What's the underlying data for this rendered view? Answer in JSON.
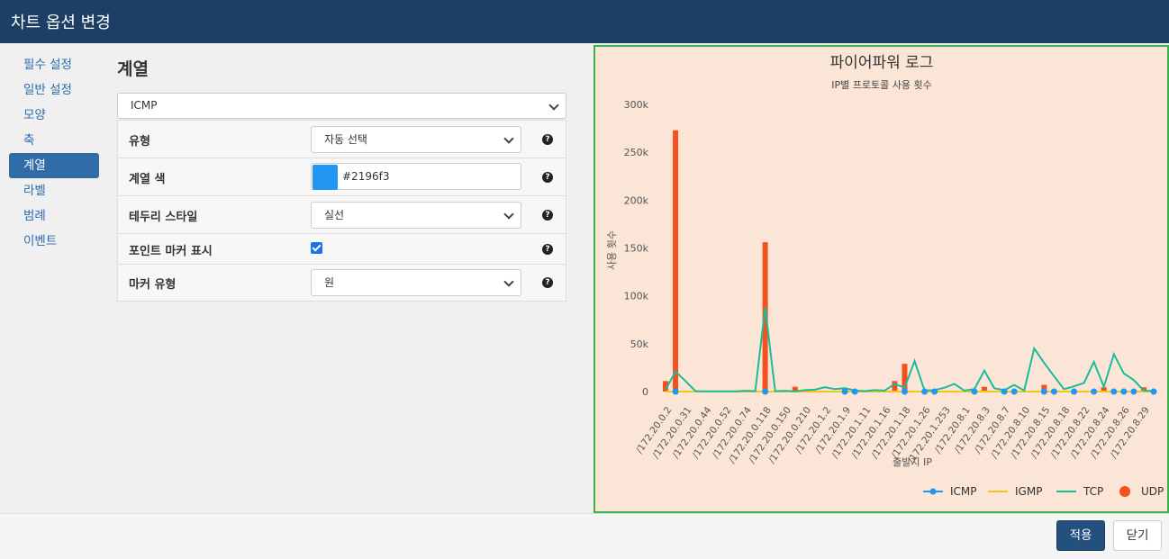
{
  "dialog": {
    "title": "차트 옵션 변경"
  },
  "sidebar": {
    "items": [
      {
        "label": "필수 설정",
        "active": false
      },
      {
        "label": "일반 설정",
        "active": false
      },
      {
        "label": "모양",
        "active": false
      },
      {
        "label": "축",
        "active": false
      },
      {
        "label": "계열",
        "active": true
      },
      {
        "label": "라벨",
        "active": false
      },
      {
        "label": "범례",
        "active": false
      },
      {
        "label": "이벤트",
        "active": false
      }
    ]
  },
  "series_panel": {
    "title": "계열",
    "series_select": "ICMP",
    "rows": {
      "type": {
        "label": "유형",
        "value": "자동 선택"
      },
      "color": {
        "label": "계열 색",
        "value": "#2196f3"
      },
      "border_style": {
        "label": "테두리 스타일",
        "value": "실선"
      },
      "show_marker": {
        "label": "포인트 마커 표시",
        "checked": true
      },
      "marker_type": {
        "label": "마커 유형",
        "value": "원"
      }
    },
    "help_glyph": "?"
  },
  "chart_data": {
    "type": "bar",
    "title": "파이어파워 로그",
    "subtitle": "IP별 프로토콜 사용 횟수",
    "xlabel": "출발지 IP",
    "ylabel": "사용 횟수",
    "ylim": [
      0,
      300000
    ],
    "yticks": [
      "0",
      "50k",
      "100k",
      "150k",
      "200k",
      "250k",
      "300k"
    ],
    "grid": false,
    "legend_position": "bottom-right",
    "background": "#fbe5d6",
    "categories": [
      "/172.20.0.2",
      "/172.20.0.31",
      "/172.20.0.44",
      "/172.20.0.52",
      "/172.20.0.74",
      "/172.20.0.118",
      "/172.20.0.150",
      "/172.20.0.210",
      "/172.20.1.2",
      "/172.20.1.9",
      "/172.20.1.11",
      "/172.20.1.16",
      "/172.20.1.18",
      "/172.20.1.26",
      "/172.20.1.253",
      "/172.20.8.1",
      "/172.20.8.3",
      "/172.20.8.7",
      "/172.20.8.10",
      "/172.20.8.15",
      "/172.20.8.18",
      "/172.20.8.22",
      "/172.20.8.24",
      "/172.20.8.26",
      "/172.20.8.29"
    ],
    "series": [
      {
        "name": "ICMP",
        "type": "line",
        "color": "#2196f3",
        "values": [
          0,
          0,
          null,
          null,
          null,
          0,
          0,
          null,
          null,
          0,
          0,
          0,
          0,
          0,
          0,
          0,
          0,
          0,
          0,
          0,
          0,
          0,
          0,
          0,
          0,
          0,
          0,
          0,
          0,
          0,
          0,
          0,
          0,
          0,
          0,
          0,
          0,
          0,
          0,
          0,
          0,
          0,
          0,
          0,
          0,
          0,
          0,
          0,
          0,
          0
        ]
      },
      {
        "name": "IGMP",
        "type": "line",
        "color": "#f5c518",
        "values": [
          0,
          0,
          0,
          0,
          0,
          0,
          0,
          0,
          0,
          0,
          0,
          0,
          0,
          0,
          0,
          0,
          0,
          0,
          0,
          0,
          0,
          0,
          0,
          0,
          0,
          0,
          0,
          0,
          0,
          0,
          0,
          0,
          0,
          0,
          0,
          0,
          0,
          0,
          0,
          0,
          0,
          0,
          0,
          0,
          0,
          0,
          0,
          0,
          0,
          0
        ]
      },
      {
        "name": "TCP",
        "type": "line",
        "color": "#1abc9c",
        "values": [
          2000,
          21000,
          11000,
          500,
          200,
          200,
          200,
          300,
          800,
          500,
          88000,
          500,
          800,
          200,
          1500,
          2000,
          4500,
          2500,
          3500,
          1000,
          500,
          1500,
          1000,
          8000,
          4000,
          32000,
          1000,
          1500,
          4000,
          8000,
          1000,
          2500,
          22000,
          3500,
          1500,
          7000,
          1000,
          45000,
          30000,
          16000,
          2500,
          5500,
          9000,
          31000,
          5000,
          39000,
          19000,
          12000,
          1000,
          500
        ]
      },
      {
        "name": "UDP",
        "type": "bar",
        "color": "#f4511e",
        "values": [
          11000,
          273000,
          0,
          0,
          0,
          0,
          0,
          0,
          0,
          0,
          156000,
          0,
          0,
          5000,
          0,
          0,
          0,
          0,
          0,
          0,
          0,
          0,
          0,
          11000,
          29000,
          0,
          0,
          0,
          0,
          0,
          0,
          0,
          5000,
          0,
          0,
          0,
          0,
          0,
          7000,
          0,
          0,
          0,
          0,
          0,
          4500,
          0,
          0,
          0,
          4500,
          0
        ]
      }
    ],
    "legend": [
      "ICMP",
      "IGMP",
      "TCP",
      "UDP"
    ]
  },
  "footer": {
    "apply_label": "적용",
    "close_label": "닫기"
  }
}
